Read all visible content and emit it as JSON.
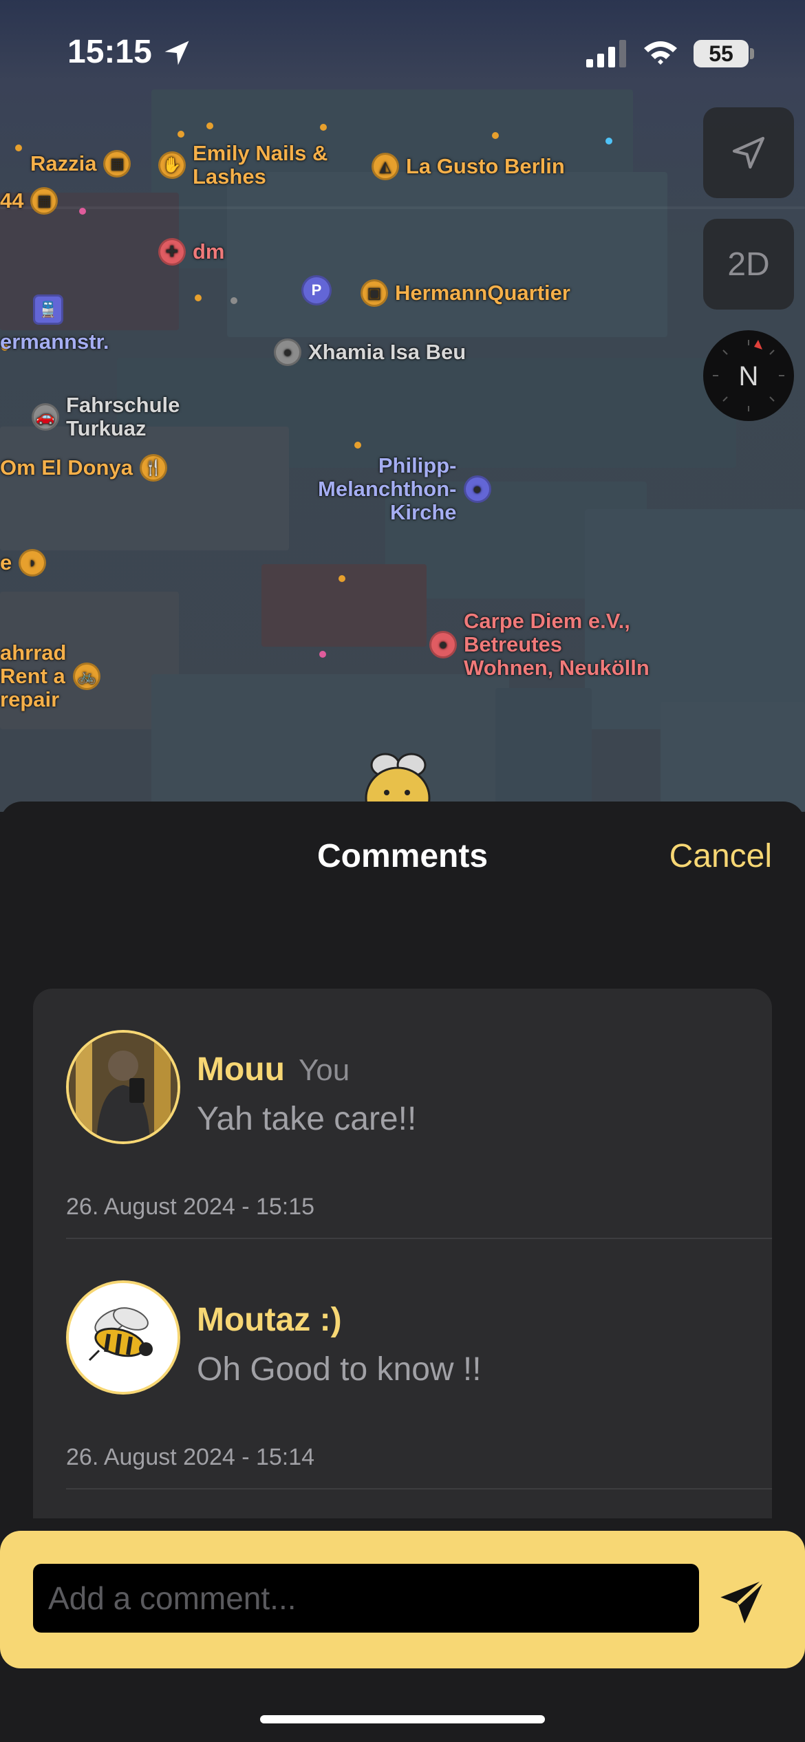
{
  "status_bar": {
    "time": "15:15",
    "battery": "55"
  },
  "map": {
    "controls": {
      "mode_2d": "2D",
      "compass_label": "N"
    },
    "pois": [
      {
        "label": "Razzia",
        "icon": "shop-icon",
        "color": "orange"
      },
      {
        "label": "Emily Nails &\nLashes",
        "icon": "nails-icon",
        "color": "orange"
      },
      {
        "label": "La Gusto Berlin",
        "icon": "pizza-icon",
        "color": "orange"
      },
      {
        "label": "44",
        "icon": "shop-icon",
        "color": "orange"
      },
      {
        "label": "dm",
        "icon": "pharmacy-icon",
        "color": "red"
      },
      {
        "label": "HermannQuartier",
        "icon": "shopping-icon",
        "color": "orange"
      },
      {
        "label": "ermannstr.",
        "icon": "train-icon",
        "color": "blue"
      },
      {
        "label": "Xhamia Isa Beu",
        "icon": "place-icon",
        "color": "gray"
      },
      {
        "label": "Fahrschule\nTurkuaz",
        "icon": "car-icon",
        "color": "gray"
      },
      {
        "label": "Om El Donya",
        "icon": "restaurant-icon",
        "color": "orange"
      },
      {
        "label": "Philipp-\nMelanchthon-\nKirche",
        "icon": "church-icon",
        "color": "blue"
      },
      {
        "label": "Carpe Diem e.V.,\nBetreutes\nWohnen, Neukölln",
        "icon": "place-icon",
        "color": "red"
      },
      {
        "label": "ahrrad\nRent a\nrepair",
        "icon": "bicycle-icon",
        "color": "orange"
      },
      {
        "label": "e",
        "icon": "bakery-icon",
        "color": "orange"
      }
    ]
  },
  "sheet": {
    "title": "Comments",
    "cancel_label": "Cancel",
    "comments": [
      {
        "author": "Mouu",
        "you_tag": "You",
        "text": "Yah take care!!",
        "timestamp": "26. August 2024 - 15:15"
      },
      {
        "author": "Moutaz :)",
        "you_tag": "",
        "text": "Oh Good to know !!",
        "timestamp": "26. August 2024 - 15:14"
      }
    ],
    "input": {
      "placeholder": "Add a comment..."
    }
  }
}
